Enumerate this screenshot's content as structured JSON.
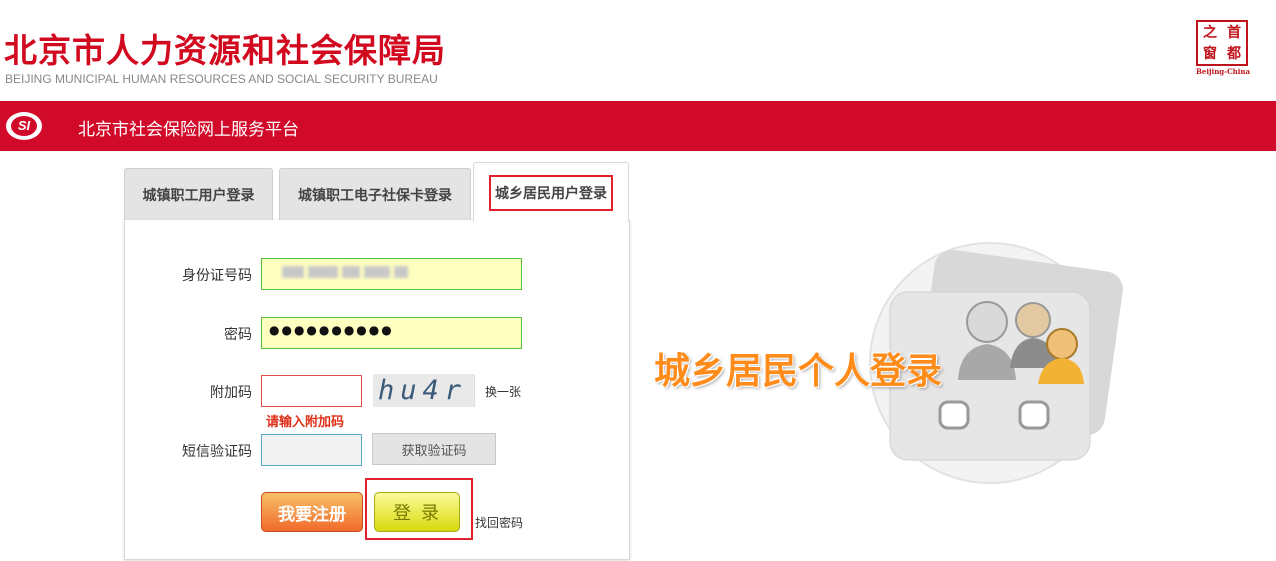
{
  "header": {
    "title": "北京市人力资源和社会保障局",
    "subtitle": "BEIJING MUNICIPAL HUMAN RESOURCES AND SOCIAL SECURITY BUREAU",
    "seal": {
      "chars": [
        "之",
        "首",
        "窗",
        "都"
      ],
      "caption": "Beijing-China"
    }
  },
  "platform": {
    "logo_text": "SI",
    "title": "北京市社会保险网上服务平台"
  },
  "tabs": [
    {
      "label": "城镇职工用户登录",
      "active": false
    },
    {
      "label": "城镇职工电子社保卡登录",
      "active": false
    },
    {
      "label": "城乡居民用户登录",
      "active": true
    }
  ],
  "form": {
    "id_label": "身份证号码",
    "id_value": "",
    "password_label": "密码",
    "password_value": "●●●●●●●●●●",
    "captcha_label": "附加码",
    "captcha_value": "",
    "captcha_image_text": "hu4r",
    "captcha_refresh": "换一张",
    "captcha_error": "请输入附加码",
    "sms_label": "短信验证码",
    "sms_value": "",
    "get_code_button": "获取验证码",
    "register_button": "我要注册",
    "login_button": "登录",
    "forgot_password": "找回密码"
  },
  "illustration": {
    "caption": "城乡居民个人登录"
  },
  "colors": {
    "brand_red": "#d20a2a",
    "accent_orange": "#ff8c1a",
    "error_red": "#e03018"
  }
}
